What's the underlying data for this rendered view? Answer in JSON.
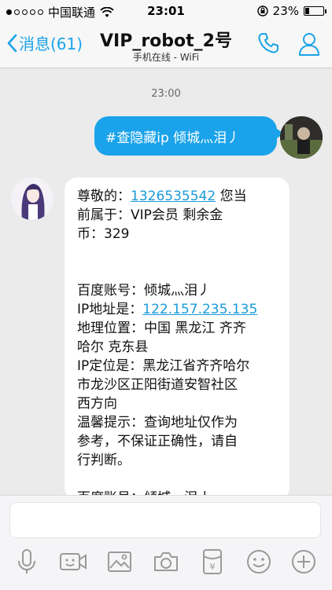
{
  "status_bar": {
    "carrier": "中国联通",
    "time": "23:01",
    "battery": "23%",
    "battery_level": 0.23,
    "signal_dots_filled": 1,
    "signal_dots_total": 5
  },
  "nav": {
    "back_label": "消息(61)",
    "title": "VIP_robot_2号",
    "subtitle": "手机在线 - WiFi",
    "accent_color": "#1aa3e8"
  },
  "chat": {
    "timestamp": "23:00",
    "outgoing": {
      "text": "#查隐藏ip 倾城灬泪丿",
      "bubble_color": "#1aa3ea"
    },
    "incoming": {
      "greeting_prefix": "尊敬的：",
      "phone": "1326535542",
      "greeting_suffix": " 您当",
      "line2": "前属于：VIP会员 剩余金",
      "line3": "币：329",
      "account_label": "百度账号：倾城灬泪丿",
      "ip_prefix": "IP地址是：",
      "ip_value": "122.157.235.135",
      "geo_line1": "地理位置：中国 黑龙江 齐齐",
      "geo_line2": "哈尔 克东县",
      "ipgeo_line1": "IP定位是：黑龙江省齐齐哈尔",
      "ipgeo_line2": "市龙沙区正阳街道安智社区",
      "ipgeo_line3": "西方向",
      "tip_line1": "温馨提示：查询地址仅作为",
      "tip_line2": "参考，不保证正确性，请自",
      "tip_line3": "行判断。",
      "account_label_repeat": "百度账号：倾城灬泪丿"
    }
  },
  "input": {
    "placeholder": ""
  },
  "toolbar": {
    "icons": [
      "microphone-icon",
      "video-icon",
      "image-icon",
      "camera-icon",
      "red-packet-icon",
      "emoji-icon",
      "plus-icon"
    ]
  }
}
